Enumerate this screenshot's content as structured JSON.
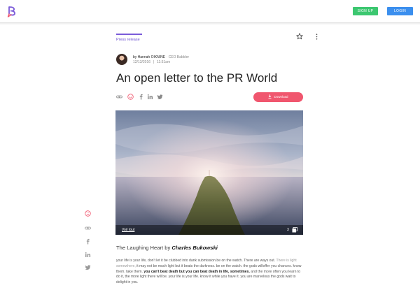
{
  "header": {
    "logo_icon": "babbler-logo-icon",
    "signup_label": "SIGN UP",
    "login_label": "LOGIN",
    "signup_color": "#3cc770",
    "login_color": "#3b8fee"
  },
  "article": {
    "tag": "Press release",
    "author_prefix": "by Hannah OIKNINE",
    "author_role": "· CEO Babbler",
    "date": "12/13/2016",
    "time": "11:51am",
    "title": "An open letter to the PR World",
    "download_label": "Download",
    "download_color": "#f0566e",
    "share_icons": [
      "link-icon",
      "reaction-icon",
      "facebook-icon",
      "linkedin-icon",
      "twitter-icon"
    ]
  },
  "hero": {
    "see_all_label": "Voir tout",
    "image_count": "3",
    "gallery_icon": "gallery-icon"
  },
  "left_rail": {
    "icons": [
      "reaction-icon",
      "link-icon",
      "facebook-icon",
      "linkedin-icon",
      "twitter-icon"
    ]
  },
  "content": {
    "subheading_prefix": "The Laughing Heart by",
    "subheading_author": "Charles Bukowski",
    "p1": "your life is your life, don't let it be clubbed into dank submission.be on the watch. There are ways out.",
    "p2": "There is light somewhere,",
    "p3": "it may not be much light but it beats the darkness. be on the watch. the gods willoffer you chances. know them. take them.",
    "p4": "you can't beat death but you can beat death in life, sometimes.",
    "p5": "and the more often you learn to do it, the more light there will be. your life is your life. know it while you have it. you are marvelous the gods wait to delight in you."
  }
}
